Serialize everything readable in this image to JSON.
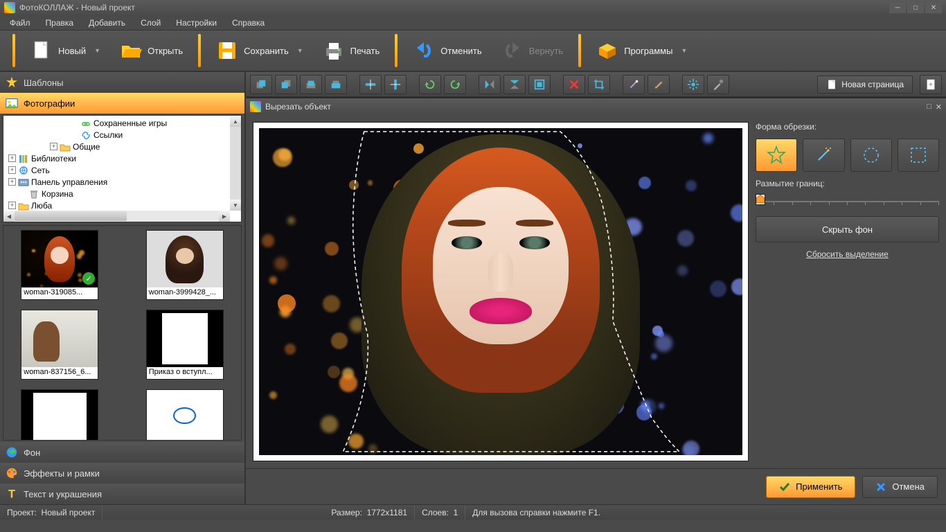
{
  "app": {
    "title": "ФотоКОЛЛАЖ - Новый проект"
  },
  "menu": {
    "items": [
      "Файл",
      "Правка",
      "Добавить",
      "Слой",
      "Настройки",
      "Справка"
    ]
  },
  "toolbar": {
    "new": "Новый",
    "open": "Открыть",
    "save": "Сохранить",
    "print": "Печать",
    "undo": "Отменить",
    "redo": "Вернуть",
    "programs": "Программы"
  },
  "left": {
    "templates": "Шаблоны",
    "photos": "Фотографии",
    "tree": {
      "items": [
        {
          "indent": 95,
          "icon": "game",
          "label": "Сохраненные игры"
        },
        {
          "indent": 95,
          "icon": "link",
          "label": "Ссылки"
        },
        {
          "indent": 65,
          "box": "+",
          "icon": "folder",
          "label": "Общие"
        },
        {
          "indent": 5,
          "box": "+",
          "icon": "lib",
          "label": "Библиотеки"
        },
        {
          "indent": 5,
          "box": "+",
          "icon": "net",
          "label": "Сеть"
        },
        {
          "indent": 5,
          "box": "+",
          "icon": "panel",
          "label": "Панель управления"
        },
        {
          "indent": 20,
          "icon": "trash",
          "label": "Корзина"
        },
        {
          "indent": 5,
          "box": "+",
          "icon": "folder",
          "label": "Люба"
        }
      ]
    },
    "thumbs": [
      {
        "label": "woman-319085...",
        "kind": "p1"
      },
      {
        "label": "woman-3999428_...",
        "kind": "p2"
      },
      {
        "label": "woman-837156_6...",
        "kind": "p3"
      },
      {
        "label": "Приказ о вступл...",
        "kind": "doc"
      },
      {
        "label": "",
        "kind": "doc2"
      },
      {
        "label": "",
        "kind": "doc3"
      }
    ],
    "background": "Фон",
    "effects": "Эффекты и рамки",
    "text": "Текст и украшения"
  },
  "icontoolbar": {
    "newpage": "Новая страница"
  },
  "dialog": {
    "title": "Вырезать объект",
    "crop_shape": "Форма обрезки:",
    "blur_edges": "Размытие границ:",
    "hide_bg": "Скрыть фон",
    "reset_sel": "Сбросить выделение",
    "apply": "Применить",
    "cancel": "Отмена"
  },
  "status": {
    "project_label": "Проект:",
    "project_name": "Новый проект",
    "size_label": "Размер:",
    "size_value": "1772x1181",
    "layers_label": "Слоев:",
    "layers_value": "1",
    "help": "Для вызова справки нажмите F1."
  }
}
